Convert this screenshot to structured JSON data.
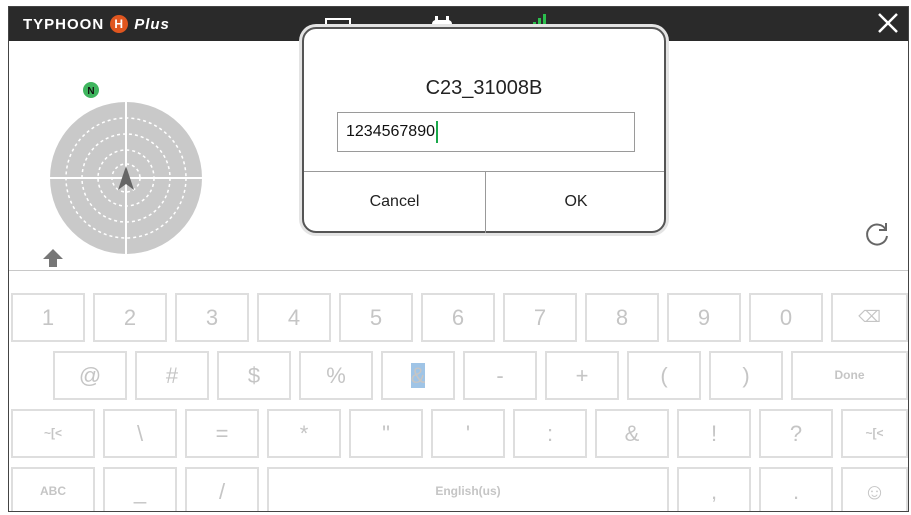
{
  "topbar": {
    "brand_prefix": "TYPHOON",
    "brand_logo": "H",
    "brand_suffix": "Plus",
    "icons": [
      "camera-status-icon",
      "controller-icon",
      "signal-bars-icon",
      "more-icon"
    ],
    "signal_color": "#2bbf4d",
    "logo_color": "#e0561f"
  },
  "compass": {
    "north_label": "N",
    "north_color": "#3fb55e"
  },
  "dialog": {
    "title": "C23_31008B",
    "input_value": "1234567890",
    "cancel_label": "Cancel",
    "ok_label": "OK"
  },
  "keyboard": {
    "row1": [
      "1",
      "2",
      "3",
      "4",
      "5",
      "6",
      "7",
      "8",
      "9",
      "0",
      "⌫"
    ],
    "row2": [
      "@",
      "#",
      "$",
      "%",
      "&",
      "-",
      "+",
      "(",
      ")",
      "Done"
    ],
    "row3": [
      "~[<",
      "\\",
      "=",
      "*",
      "\"",
      "'",
      ":",
      "&",
      "!",
      "?",
      "~[<"
    ],
    "row4": [
      "ABC",
      "_",
      "/",
      "English(us)",
      ",",
      ".",
      "☺"
    ],
    "selected_key": "&",
    "selected_color": "#9fc4e6"
  }
}
